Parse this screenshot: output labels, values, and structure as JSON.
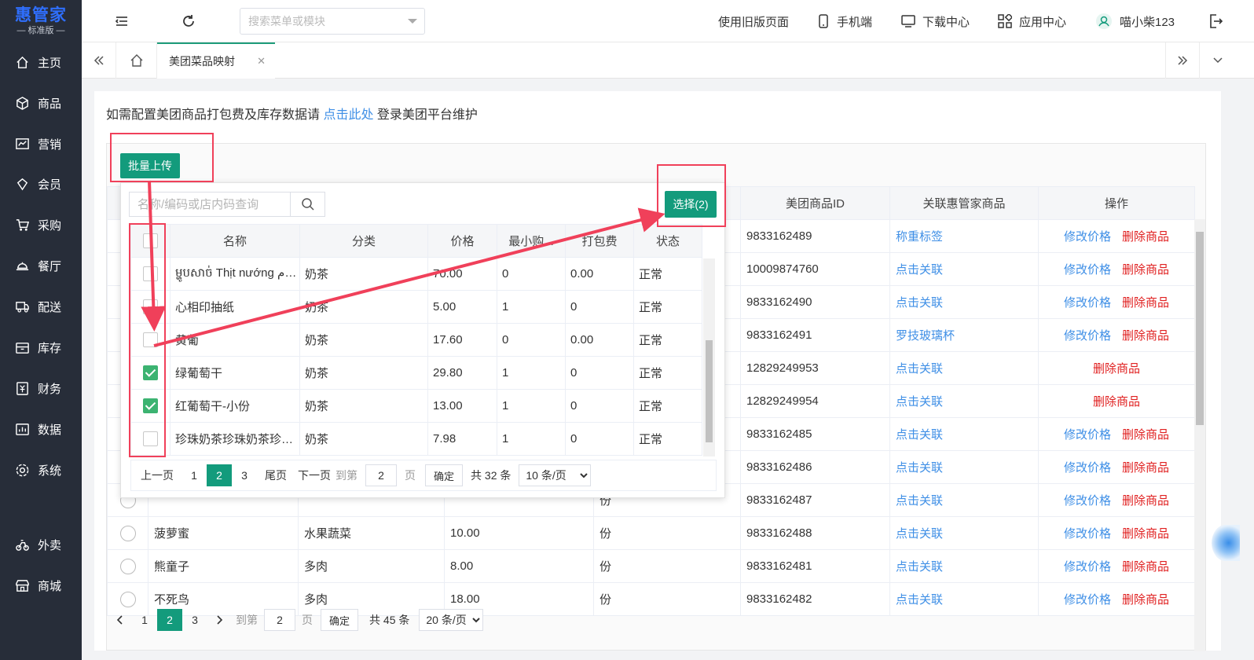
{
  "logo": {
    "name": "惠管家",
    "edition": "— 标准版 —"
  },
  "sidebar": {
    "items": [
      {
        "label": "主页",
        "icon": "home-icon"
      },
      {
        "label": "商品",
        "icon": "cube-icon"
      },
      {
        "label": "营销",
        "icon": "chart-icon"
      },
      {
        "label": "会员",
        "icon": "diamond-icon"
      },
      {
        "label": "采购",
        "icon": "cart-icon"
      },
      {
        "label": "餐厅",
        "icon": "dish-icon"
      },
      {
        "label": "配送",
        "icon": "truck-icon"
      },
      {
        "label": "库存",
        "icon": "inventory-icon"
      },
      {
        "label": "财务",
        "icon": "finance-icon"
      },
      {
        "label": "数据",
        "icon": "data-icon"
      },
      {
        "label": "系统",
        "icon": "settings-icon"
      },
      {
        "label": "外卖",
        "icon": "bike-icon"
      },
      {
        "label": "商城",
        "icon": "store-icon"
      }
    ]
  },
  "topbar": {
    "search_placeholder": "搜索菜单或模块",
    "old_page": "使用旧版页面",
    "mobile": "手机端",
    "download": "下载中心",
    "apps": "应用中心",
    "user": "喵小柴123"
  },
  "tabs": {
    "active": "美团菜品映射"
  },
  "notice": {
    "prefix": "如需配置美团商品打包费及库存数据请 ",
    "link": "点击此处",
    "suffix": " 登录美团平台维护"
  },
  "batch_upload": "批量上传",
  "main_table": {
    "headers": [
      "",
      "",
      "",
      "",
      "",
      "美团商品ID",
      "关联惠管家商品",
      "操作"
    ],
    "rows": [
      {
        "name": "",
        "category": "",
        "price": "",
        "unit": "",
        "mt_id": "9833162489",
        "linked": "称重标签",
        "linked_is_link": false,
        "edit": "修改价格",
        "del": "删除商品"
      },
      {
        "name": "",
        "category": "",
        "price": "",
        "unit": "",
        "mt_id": "10009874760",
        "linked": "点击关联",
        "edit": "修改价格",
        "del": "删除商品"
      },
      {
        "name": "",
        "category": "",
        "price": "",
        "unit": "",
        "mt_id": "9833162490",
        "linked": "点击关联",
        "edit": "修改价格",
        "del": "删除商品"
      },
      {
        "name": "",
        "category": "",
        "price": "",
        "unit": "",
        "mt_id": "9833162491",
        "linked": "罗技玻璃杯",
        "edit": "修改价格",
        "del": "删除商品"
      },
      {
        "name": "",
        "category": "",
        "price": "",
        "unit": "",
        "mt_id": "12829249953",
        "linked": "点击关联",
        "edit": "",
        "del": "删除商品"
      },
      {
        "name": "",
        "category": "",
        "price": "",
        "unit": "",
        "mt_id": "12829249954",
        "linked": "点击关联",
        "edit": "",
        "del": "删除商品"
      },
      {
        "name": "",
        "category": "",
        "price": "",
        "unit": "",
        "mt_id": "9833162485",
        "linked": "点击关联",
        "edit": "修改价格",
        "del": "删除商品"
      },
      {
        "name": "",
        "category": "",
        "price": "",
        "unit": "",
        "mt_id": "9833162486",
        "linked": "点击关联",
        "edit": "修改价格",
        "del": "删除商品"
      },
      {
        "name": "",
        "category": "",
        "price": "",
        "unit": "份",
        "mt_id": "9833162487",
        "linked": "点击关联",
        "edit": "修改价格",
        "del": "删除商品"
      },
      {
        "name": "菠萝蜜",
        "category": "水果蔬菜",
        "price": "10.00",
        "unit": "份",
        "mt_id": "9833162488",
        "linked": "点击关联",
        "edit": "修改价格",
        "del": "删除商品"
      },
      {
        "name": "熊童子",
        "category": "多肉",
        "price": "8.00",
        "unit": "份",
        "mt_id": "9833162481",
        "linked": "点击关联",
        "edit": "修改价格",
        "del": "删除商品"
      },
      {
        "name": "不死鸟",
        "category": "多肉",
        "price": "18.00",
        "unit": "份",
        "mt_id": "9833162482",
        "linked": "点击关联",
        "edit": "修改价格",
        "del": "删除商品"
      }
    ]
  },
  "main_pager": {
    "pages": [
      "1",
      "2",
      "3"
    ],
    "current": "2",
    "goto_label": "到第",
    "goto_value": "2",
    "page_unit": "页",
    "confirm": "确定",
    "total": "共 45 条",
    "page_size": "20 条/页"
  },
  "popup": {
    "search_placeholder": "名称/编码或店内码查询",
    "select_button": "选择(2)",
    "headers": [
      "",
      "名称",
      "分类",
      "价格",
      "最小购...",
      "打包费",
      "状态"
    ],
    "rows": [
      {
        "checked": false,
        "name": "ម្ហូបសាច់ Thịt nướng طعام",
        "category": "奶茶",
        "price": "70.00",
        "min": "0",
        "pack": "0.00",
        "status": "正常"
      },
      {
        "checked": false,
        "name": "心相印抽纸",
        "category": "奶茶",
        "price": "5.00",
        "min": "1",
        "pack": "0",
        "status": "正常"
      },
      {
        "checked": false,
        "name": "黄葡",
        "category": "奶茶",
        "price": "17.60",
        "min": "0",
        "pack": "0.00",
        "status": "正常"
      },
      {
        "checked": true,
        "name": "绿葡萄干",
        "category": "奶茶",
        "price": "29.80",
        "min": "1",
        "pack": "0",
        "status": "正常"
      },
      {
        "checked": true,
        "name": "红葡萄干-小份",
        "category": "奶茶",
        "price": "13.00",
        "min": "1",
        "pack": "0",
        "status": "正常"
      },
      {
        "checked": false,
        "name": "珍珠奶茶珍珠奶茶珍珠奶茶",
        "category": "奶茶",
        "price": "7.98",
        "min": "1",
        "pack": "0",
        "status": "正常"
      }
    ],
    "pager": {
      "prev": "上一页",
      "pages": [
        "1",
        "2",
        "3"
      ],
      "current": "2",
      "last": "尾页",
      "next": "下一页",
      "goto_label": "到第",
      "goto_value": "2",
      "page_unit": "页",
      "confirm": "确定",
      "total": "共 32 条",
      "page_size": "10 条/页"
    }
  },
  "colors": {
    "sidebar": "#272d39",
    "primary": "#139b7c",
    "link": "#3f8fe6",
    "danger": "#e02020",
    "highlight": "#f0405a"
  }
}
